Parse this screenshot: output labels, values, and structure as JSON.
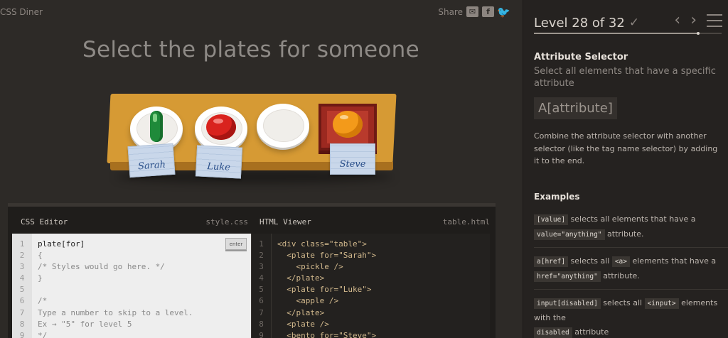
{
  "app": {
    "logo": "CSS Diner"
  },
  "share": {
    "label": "Share",
    "icons": [
      "mail-icon",
      "facebook-icon",
      "twitter-icon"
    ]
  },
  "game": {
    "instruction": "Select the plates for someone",
    "tags": [
      "Sarah",
      "Luke",
      "Steve"
    ]
  },
  "css_editor": {
    "title": "CSS Editor",
    "filename": "style.css",
    "enter_label": "enter",
    "line_numbers": [
      "1",
      "2",
      "3",
      "4",
      "5",
      "6",
      "7",
      "8",
      "9"
    ],
    "lines": [
      "plate[for]",
      "{",
      "/* Styles would go here. */",
      "}",
      "",
      "/*",
      "Type a number to skip to a level.",
      "Ex → \"5\" for level 5",
      "*/"
    ]
  },
  "html_viewer": {
    "title": "HTML Viewer",
    "filename": "table.html",
    "line_numbers": [
      "1",
      "2",
      "3",
      "4",
      "5",
      "6",
      "7",
      "8",
      "9"
    ],
    "lines": [
      "<div class=\"table\">",
      "  <plate for=\"Sarah\">",
      "    <pickle />",
      "  </plate>",
      "  <plate for=\"Luke\">",
      "    <apple />",
      "  </plate>",
      "  <plate />",
      "  <bento for=\"Steve\">"
    ]
  },
  "sidebar": {
    "level_text": "Level 28 of 32",
    "progress_fraction": 0.875,
    "heading": "Attribute Selector",
    "subheading": "Select all elements that have a specific attribute",
    "syntax": "A[attribute]",
    "description": "Combine the attribute selector with another selector (like the tag name selector) by adding it to the end.",
    "examples_heading": "Examples",
    "examples": [
      {
        "code1": "[value]",
        "text1": "selects all elements that have a",
        "code2": "value=\"anything\"",
        "text2": "attribute."
      },
      {
        "code1": "a[href]",
        "text1": "selects all",
        "code2": "<a>",
        "text2": "elements that have a",
        "code3": "href=\"anything\"",
        "text3": "attribute."
      },
      {
        "code1": "input[disabled]",
        "text1": "selects all",
        "code2": "<input>",
        "text2": "elements with the",
        "code3": "disabled",
        "text3": "attribute"
      }
    ]
  },
  "colors": {
    "background": "#2d2a27",
    "sidebar": "#252220",
    "table": "#d69a34"
  }
}
